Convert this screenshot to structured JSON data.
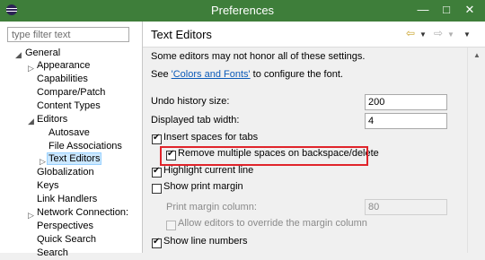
{
  "window": {
    "title": "Preferences"
  },
  "filter": {
    "placeholder": "type filter text"
  },
  "tree": {
    "general": "General",
    "appearance": "Appearance",
    "capabilities": "Capabilities",
    "compare_patch": "Compare/Patch",
    "content_types": "Content Types",
    "editors": "Editors",
    "autosave": "Autosave",
    "file_associations": "File Associations",
    "text_editors": "Text Editors",
    "globalization": "Globalization",
    "keys": "Keys",
    "link_handlers": "Link Handlers",
    "network_connections": "Network Connection:",
    "perspectives": "Perspectives",
    "quick_search": "Quick Search",
    "search": "Search"
  },
  "page": {
    "title": "Text Editors",
    "note": "Some editors may not honor all of these settings.",
    "see_prefix": "See ",
    "see_link": "'Colors and Fonts'",
    "see_suffix": " to configure the font.",
    "undo_label": "Undo history size:",
    "undo_value": "200",
    "tab_width_label": "Displayed tab width:",
    "tab_width_value": "4",
    "insert_spaces": "Insert spaces for tabs",
    "remove_spaces": "Remove multiple spaces on backspace/delete",
    "highlight_line": "Highlight current line",
    "show_print_margin": "Show print margin",
    "print_margin_label": "Print margin column:",
    "print_margin_value": "80",
    "allow_override": "Allow editors to override the margin column",
    "show_line_numbers": "Show line numbers"
  },
  "colors": {
    "titlebar": "#3e7e3a",
    "highlight": "#e0242b",
    "link": "#0b5ab8",
    "selection": "#cce8ff"
  },
  "icons": [
    "eclipse-icon",
    "minimize-icon",
    "maximize-icon",
    "close-icon",
    "back-icon",
    "forward-icon",
    "menu-icon"
  ]
}
